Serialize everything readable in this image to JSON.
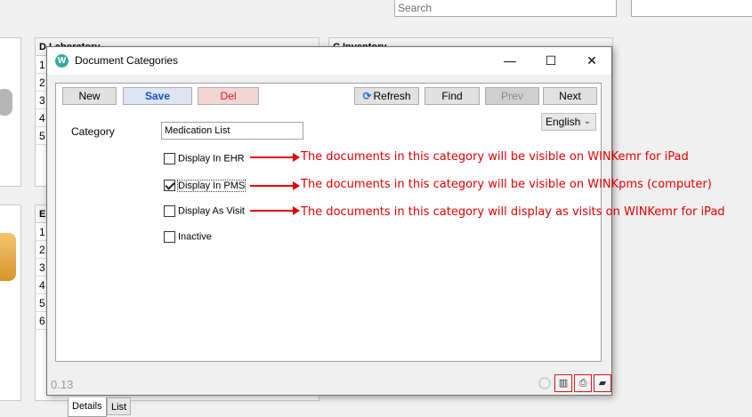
{
  "background": {
    "search_placeholder": "Search",
    "panel1_title": "D Laboratory",
    "panel2_title": "C Inventory",
    "panel3_title": "E",
    "panel1_rows": [
      "1",
      "2",
      "3",
      "4",
      "5"
    ],
    "panel3_rows": [
      "1",
      "2",
      "3",
      "4",
      "5",
      "6"
    ]
  },
  "dialog": {
    "title": "Document Categories",
    "app_icon_letter": "W",
    "window_controls": {
      "minimize": "—",
      "maximize": "☐",
      "close": "✕"
    },
    "toolbar": {
      "new": "New",
      "save": "Save",
      "del": "Del",
      "refresh": "Refresh",
      "find": "Find",
      "prev": "Prev",
      "next": "Next"
    },
    "language": "English",
    "category_label": "Category",
    "category_value": "Medication List",
    "checkboxes": [
      {
        "label": "Display In EHR",
        "checked": false
      },
      {
        "label": "Display In PMS",
        "checked": true
      },
      {
        "label": "Display As Visit",
        "checked": false
      },
      {
        "label": "Inactive",
        "checked": false
      }
    ],
    "annotations": [
      "The documents in this category will be visible on WINKemr for iPad",
      "The documents in this category will be visible on WINKpms (computer)",
      "The documents in this category will display as visits on WINKemr for iPad"
    ],
    "tabs": [
      "Details",
      "List"
    ],
    "status_text": "0.13"
  },
  "colors": {
    "annotation_red": "#e00000",
    "save_blue": "#1b4fc2",
    "del_red": "#d11a1a"
  }
}
